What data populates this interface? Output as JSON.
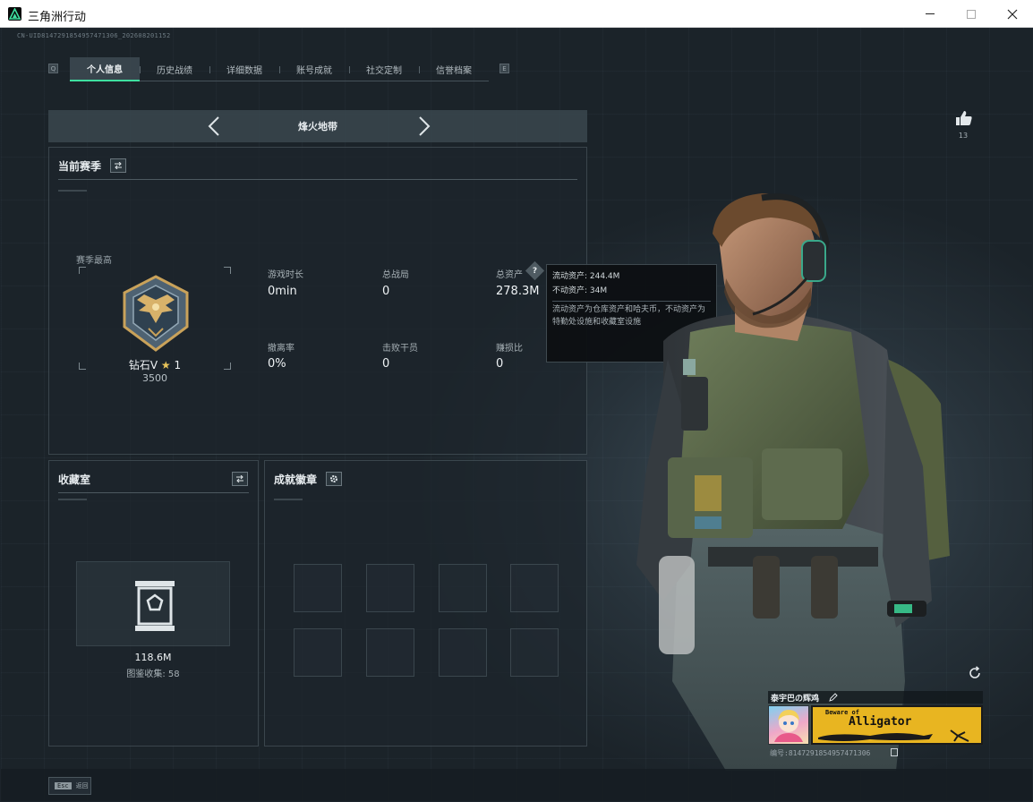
{
  "window": {
    "title": "三角洲行动",
    "uid": "CN-UID8147291854957471306_202608201152"
  },
  "tabs": [
    {
      "label": "个人信息",
      "active": true
    },
    {
      "label": "历史战绩",
      "active": false
    },
    {
      "label": "详细数据",
      "active": false
    },
    {
      "label": "账号成就",
      "active": false
    },
    {
      "label": "社交定制",
      "active": false
    },
    {
      "label": "信誉档案",
      "active": false
    }
  ],
  "tab_nav": {
    "left_key": "Q",
    "right_key": "E"
  },
  "map_selector": {
    "title": "烽火地带",
    "prev": "‹",
    "next": "›"
  },
  "current_season": {
    "title": "当前赛季",
    "season_high_label": "赛季最高",
    "rank": "钻石V",
    "stars": "1",
    "points": "3500",
    "stats": [
      {
        "label": "游戏时长",
        "value": "0min"
      },
      {
        "label": "总战局",
        "value": "0"
      },
      {
        "label": "总资产",
        "value": "278.3M"
      },
      {
        "label": "撤离率",
        "value": "0%"
      },
      {
        "label": "击败干员",
        "value": "0"
      },
      {
        "label": "赚损比",
        "value": "0"
      }
    ],
    "help_glyph": "?"
  },
  "tooltip": {
    "liquid": "流动资产: 244.4M",
    "fixed": "不动资产: 34M",
    "description": "流动资产为仓库资产和哈夫币，不动资产为特勤处设施和收藏室设施"
  },
  "collection": {
    "title": "收藏室",
    "value": "118.6M",
    "catalog": "图鉴收集: 58"
  },
  "badges": {
    "title": "成就徽章",
    "slots": 8
  },
  "profile": {
    "likes": "13",
    "player_name": "泰宇巴の辉鸡",
    "banner_small": "Beware of",
    "banner_big": "Alligator",
    "player_id": "编号:8147291854957471306"
  },
  "bottom": {
    "esc_key": "Esc",
    "esc_label": "返回"
  },
  "colors": {
    "accent": "#3ee0a0",
    "banner": "#e8b521"
  }
}
